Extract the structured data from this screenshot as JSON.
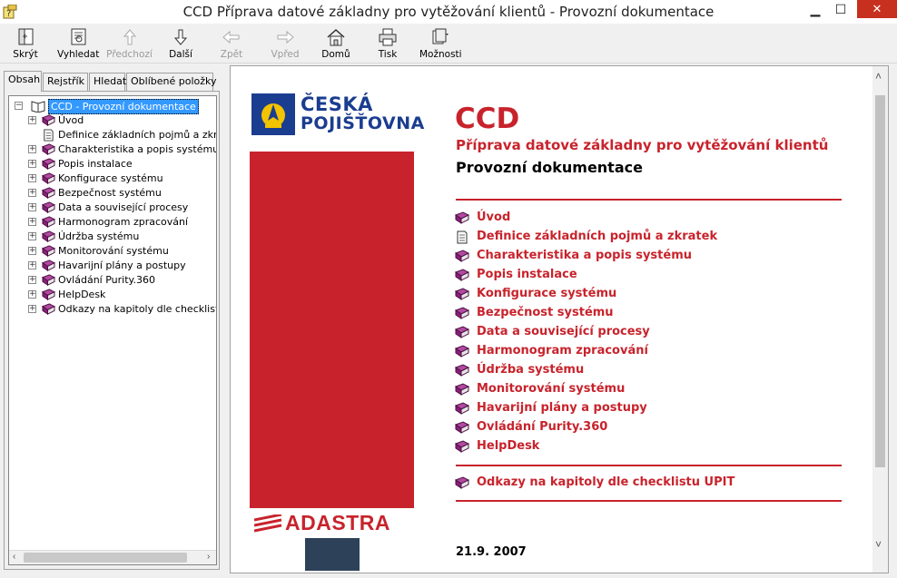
{
  "window": {
    "title": "CCD Příprava datové základny pro vytěžování klientů - Provozní dokumentace",
    "controls": {
      "minimize": "▁",
      "maximize": "☐",
      "close": "✕"
    }
  },
  "toolbar": {
    "hide": "Skrýt",
    "find": "Vyhledat",
    "prev": "Předchozí",
    "next": "Další",
    "back": "Zpět",
    "forward": "Vpřed",
    "home": "Domů",
    "print": "Tisk",
    "options": "Možnosti"
  },
  "tabs": [
    "Obsah",
    "Rejstřík",
    "Hledat",
    "Oblíbené položky"
  ],
  "tree": {
    "root": "CCD - Provozní dokumentace",
    "items": [
      {
        "label": "Úvod",
        "type": "book"
      },
      {
        "label": "Definice základních pojmů a zkratek",
        "type": "page"
      },
      {
        "label": "Charakteristika a popis systému",
        "type": "book"
      },
      {
        "label": "Popis instalace",
        "type": "book"
      },
      {
        "label": "Konfigurace systému",
        "type": "book"
      },
      {
        "label": "Bezpečnost systému",
        "type": "book"
      },
      {
        "label": "Data a související procesy",
        "type": "book"
      },
      {
        "label": "Harmonogram zpracování",
        "type": "book"
      },
      {
        "label": "Údržba systému",
        "type": "book"
      },
      {
        "label": "Monitorování systému",
        "type": "book"
      },
      {
        "label": "Havarijní plány a postupy",
        "type": "book"
      },
      {
        "label": "Ovládání Purity.360",
        "type": "book"
      },
      {
        "label": "HelpDesk",
        "type": "book"
      },
      {
        "label": "Odkazy na kapitoly dle checklistu UPIT",
        "type": "book"
      }
    ]
  },
  "content": {
    "logo_line1": "ČESKÁ",
    "logo_line2": "POJIŠŤOVNA",
    "heading": "CCD",
    "subtitle": "Příprava datové základny pro vytěžování klientů",
    "doc_title": "Provozní dokumentace",
    "links": [
      {
        "label": "Úvod",
        "type": "book"
      },
      {
        "label": "Definice základních pojmů a zkratek",
        "type": "page"
      },
      {
        "label": "Charakteristika a popis systému",
        "type": "book"
      },
      {
        "label": "Popis instalace",
        "type": "book"
      },
      {
        "label": "Konfigurace systému",
        "type": "book"
      },
      {
        "label": "Bezpečnost systému",
        "type": "book"
      },
      {
        "label": "Data a související procesy",
        "type": "book"
      },
      {
        "label": "Harmonogram zpracování",
        "type": "book"
      },
      {
        "label": "Údržba systému",
        "type": "book"
      },
      {
        "label": "Monitorování systému",
        "type": "book"
      },
      {
        "label": "Havarijní plány a postupy",
        "type": "book"
      },
      {
        "label": "Ovládání Purity.360",
        "type": "book"
      },
      {
        "label": "HelpDesk",
        "type": "book"
      }
    ],
    "extra_link": "Odkazy na kapitoly dle checklistu UPIT",
    "adastra": "ADASTRA",
    "date": "21.9. 2007"
  },
  "colors": {
    "accent_red": "#c8232c",
    "logo_blue": "#1a3d8f",
    "book_purple": "#8a1f7a"
  }
}
